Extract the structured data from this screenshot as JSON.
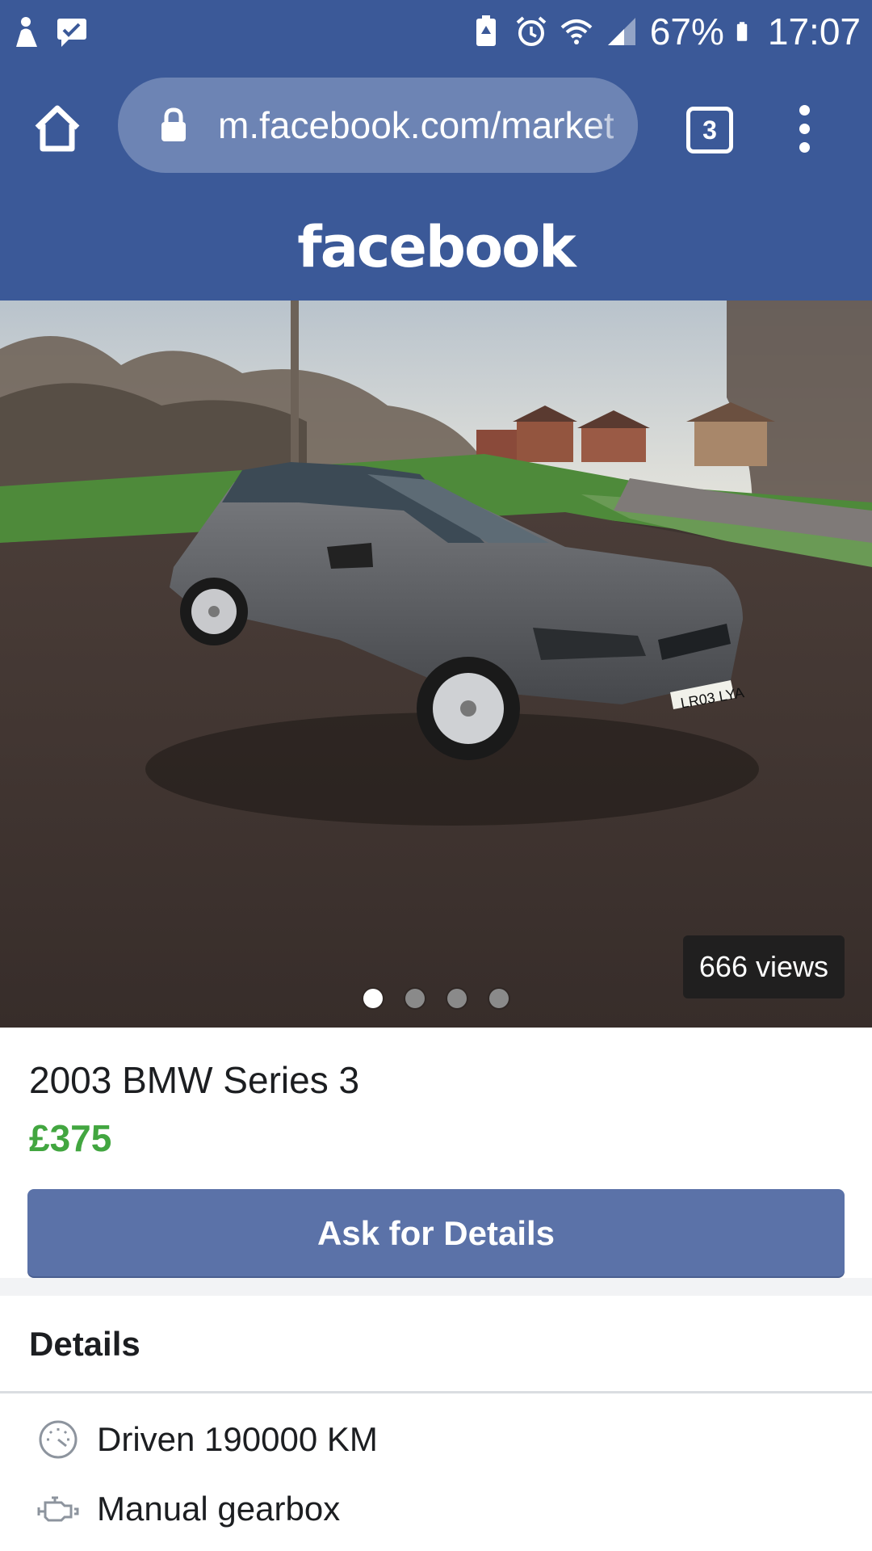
{
  "status_bar": {
    "battery_percent": "67%",
    "time": "17:07"
  },
  "browser": {
    "url": "m.facebook.com/marketplace",
    "tab_count": "3"
  },
  "header": {
    "logo_text": "facebook"
  },
  "listing": {
    "views": "666 views",
    "photo_count": 4,
    "active_photo": 1,
    "plate_text": "LR03 LYA",
    "title": "2003 BMW Series 3",
    "price": "£375",
    "ask_button_label": "Ask for Details"
  },
  "details": {
    "heading": "Details",
    "items": [
      {
        "icon": "speedometer-icon",
        "label": "Driven 190000 KM"
      },
      {
        "icon": "engine-icon",
        "label": "Manual gearbox"
      }
    ]
  },
  "colors": {
    "facebook_blue": "#3b5998",
    "price_green": "#42a640",
    "button_blue": "#5b72a8"
  }
}
